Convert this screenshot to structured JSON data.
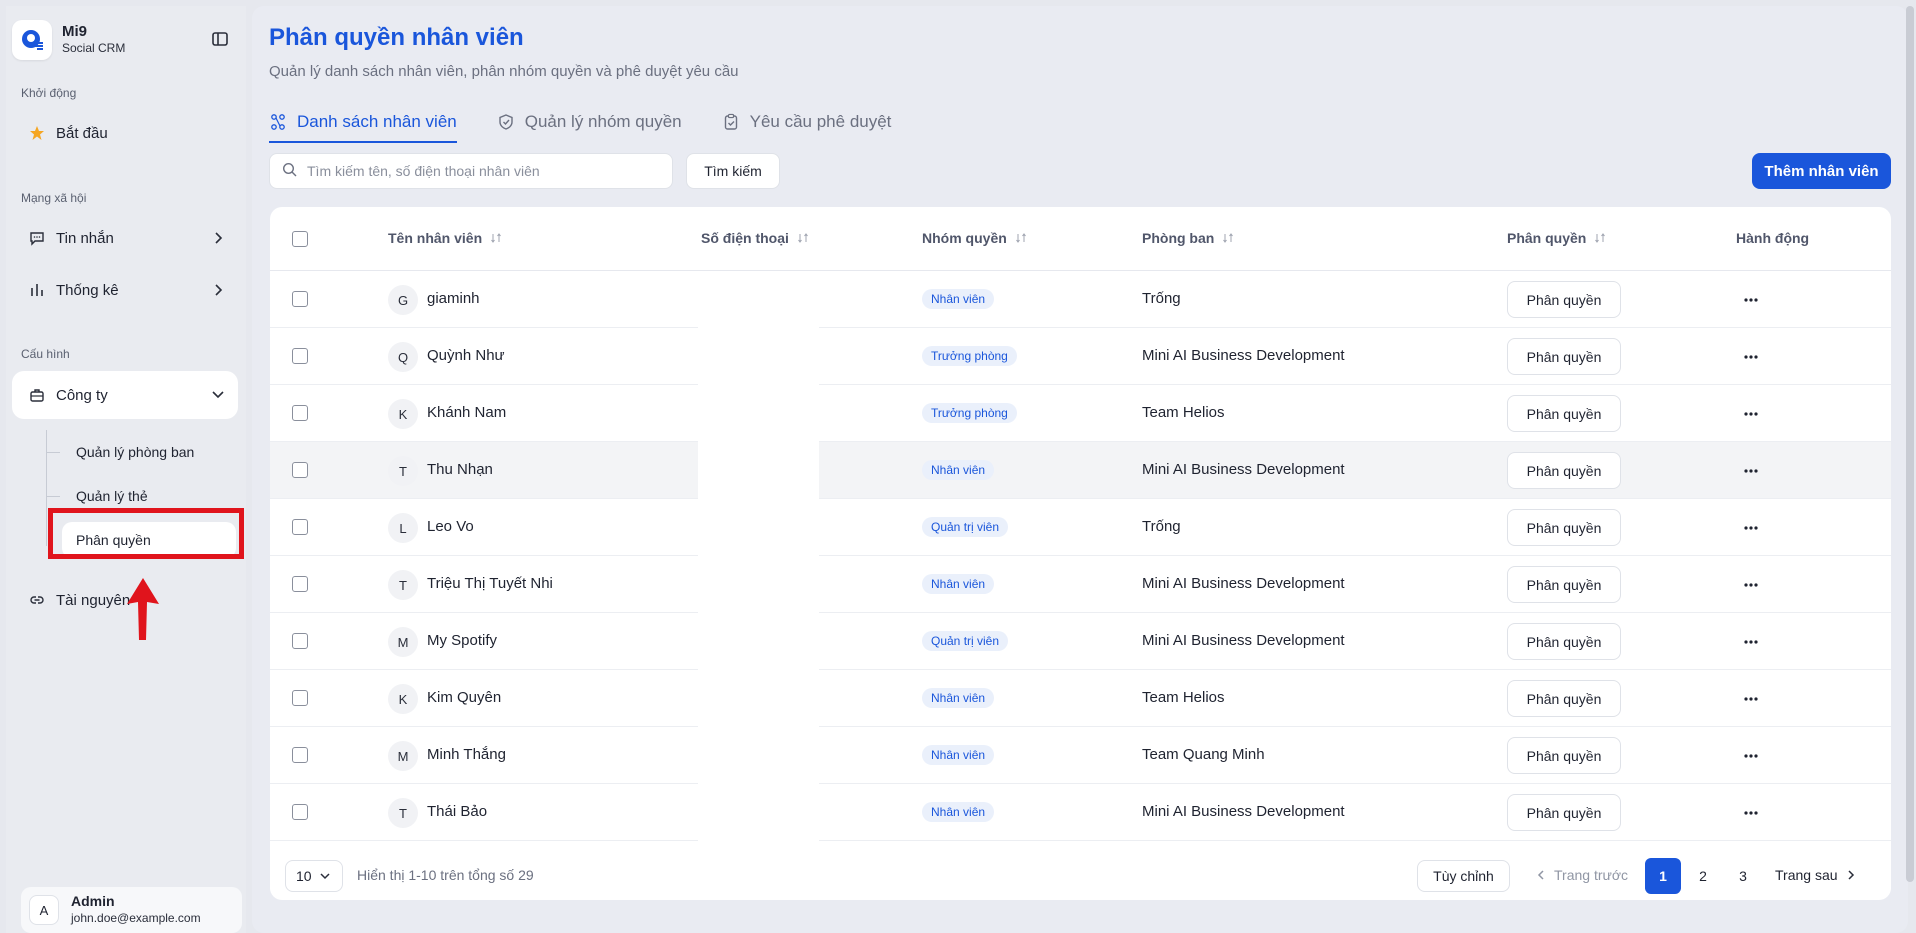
{
  "brand": {
    "name": "Mi9",
    "sub": "Social CRM"
  },
  "sidebar": {
    "sections": {
      "start": "Khởi động",
      "social": "Mạng xã hội",
      "config": "Cấu hình"
    },
    "items": {
      "start": "Bắt đầu",
      "messages": "Tin nhắn",
      "stats": "Thống kê",
      "company": "Công ty",
      "resources": "Tài nguyên"
    },
    "sub_items": {
      "departments": "Quản lý phòng ban",
      "tags": "Quản lý thẻ",
      "permissions": "Phân quyền"
    }
  },
  "user": {
    "initial": "A",
    "name": "Admin",
    "email": "john.doe@example.com"
  },
  "page": {
    "title": "Phân quyền nhân viên",
    "subtitle": "Quản lý danh sách nhân viên, phân nhóm quyền và phê duyệt yêu cầu"
  },
  "tabs": {
    "employees": "Danh sách nhân viên",
    "groups": "Quản lý nhóm quyền",
    "requests": "Yêu cầu phê duyệt"
  },
  "search": {
    "placeholder": "Tìm kiếm tên, số điện thoại nhân viên",
    "button": "Tìm kiếm",
    "add": "Thêm nhân viên"
  },
  "table": {
    "headers": {
      "name": "Tên nhân viên",
      "phone": "Số điện thoại",
      "group": "Nhóm quyền",
      "dept": "Phòng ban",
      "perm": "Phân quyền",
      "action": "Hành động"
    },
    "perm_button": "Phân quyền",
    "rows": [
      {
        "initial": "G",
        "name": "giaminh",
        "group": "Nhân viên",
        "dept": "Trống"
      },
      {
        "initial": "Q",
        "name": "Quỳnh Như",
        "group": "Trưởng phòng",
        "dept": "Mini AI Business Development"
      },
      {
        "initial": "K",
        "name": "Khánh Nam",
        "group": "Trưởng phòng",
        "dept": "Team Helios"
      },
      {
        "initial": "T",
        "name": "Thu Nhạn",
        "group": "Nhân viên",
        "dept": "Mini AI Business Development"
      },
      {
        "initial": "L",
        "name": "Leo Vo",
        "group": "Quản trị viên",
        "dept": "Trống"
      },
      {
        "initial": "T",
        "name": "Triệu Thị Tuyết Nhi",
        "group": "Nhân viên",
        "dept": "Mini AI Business Development"
      },
      {
        "initial": "M",
        "name": "My Spotify",
        "group": "Quản trị viên",
        "dept": "Mini AI Business Development"
      },
      {
        "initial": "K",
        "name": "Kim Quyên",
        "group": "Nhân viên",
        "dept": "Team Helios"
      },
      {
        "initial": "M",
        "name": "Minh Thắng",
        "group": "Nhân viên",
        "dept": "Team Quang Minh"
      },
      {
        "initial": "T",
        "name": "Thái Bảo",
        "group": "Nhân viên",
        "dept": "Mini AI Business Development"
      }
    ]
  },
  "pagination": {
    "page_size": "10",
    "info": "Hiển thị 1-10 trên tổng số 29",
    "custom": "Tùy chỉnh",
    "prev": "Trang trước",
    "pages": [
      "1",
      "2",
      "3"
    ],
    "next": "Trang sau"
  },
  "colors": {
    "accent": "#1a56db",
    "highlight": "#e0141c"
  }
}
